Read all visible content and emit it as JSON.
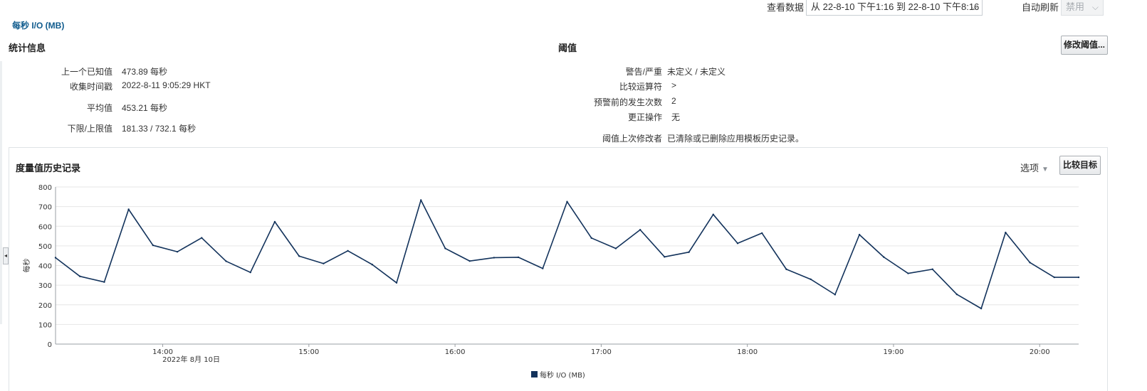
{
  "toolbar": {
    "view_data_label": "查看数据",
    "view_data_value": "从 22-8-10 下午1:16 到 22-8-10 下午8:16",
    "auto_refresh_label": "自动刷新",
    "auto_refresh_value": "禁用"
  },
  "page_title": "每秒 I/O (MB)",
  "stats": {
    "title": "统计信息",
    "rows": [
      {
        "label": "上一个已知值",
        "value": "473.89 每秒"
      },
      {
        "label": "收集时间戳",
        "value": "2022-8-11 9:05:29 HKT"
      },
      {
        "label": "平均值",
        "value": "453.21 每秒"
      },
      {
        "label": "下限/上限值",
        "value": "181.33 / 732.1 每秒"
      }
    ]
  },
  "thresholds": {
    "title": "阈值",
    "edit_button": "修改阈值...",
    "rows": [
      {
        "label": "警告/严重",
        "value": "未定义 / 未定义"
      },
      {
        "label": "比较运算符",
        "value": ">"
      },
      {
        "label": "预警前的发生次数",
        "value": "2"
      },
      {
        "label": "更正操作",
        "value": "无"
      },
      {
        "label": "阈值上次修改者",
        "value": "已清除或已删除应用模板历史记录。"
      }
    ]
  },
  "history": {
    "title": "度量值历史记录",
    "options_label": "选项",
    "compare_button": "比较目标"
  },
  "colors": {
    "series": "#12325b",
    "link_title": "#0f5b8d",
    "grid": "#e6e6e6"
  },
  "chart_data": {
    "type": "line",
    "title": "",
    "ylabel": "每秒",
    "xlabel": "",
    "date_label": "2022年 8月 10日",
    "ylim": [
      0,
      800
    ],
    "yticks": [
      0,
      100,
      200,
      300,
      400,
      500,
      600,
      700,
      800
    ],
    "xlim": [
      "13:16",
      "20:16"
    ],
    "xticks": [
      "14:00",
      "15:00",
      "16:00",
      "17:00",
      "18:00",
      "19:00",
      "20:00"
    ],
    "legend_position": "bottom",
    "grid": true,
    "series": [
      {
        "name": "每秒 I/O (MB)",
        "x": [
          "13:16",
          "13:26",
          "13:36",
          "13:46",
          "13:56",
          "14:06",
          "14:16",
          "14:26",
          "14:36",
          "14:46",
          "14:56",
          "15:06",
          "15:16",
          "15:26",
          "15:36",
          "15:46",
          "15:56",
          "16:06",
          "16:16",
          "16:26",
          "16:36",
          "16:46",
          "16:56",
          "17:06",
          "17:16",
          "17:26",
          "17:36",
          "17:46",
          "17:56",
          "18:06",
          "18:16",
          "18:26",
          "18:36",
          "18:46",
          "18:56",
          "19:06",
          "19:16",
          "19:26",
          "19:36",
          "19:46",
          "19:56",
          "20:06",
          "20:16"
        ],
        "values": [
          440,
          345,
          316,
          686,
          503,
          470,
          541,
          422,
          365,
          623,
          448,
          410,
          475,
          405,
          312,
          733,
          487,
          423,
          440,
          442,
          385,
          725,
          540,
          487,
          582,
          444,
          468,
          660,
          513,
          565,
          381,
          330,
          252,
          557,
          443,
          360,
          381,
          253,
          181,
          568,
          415,
          340,
          340
        ]
      }
    ]
  }
}
